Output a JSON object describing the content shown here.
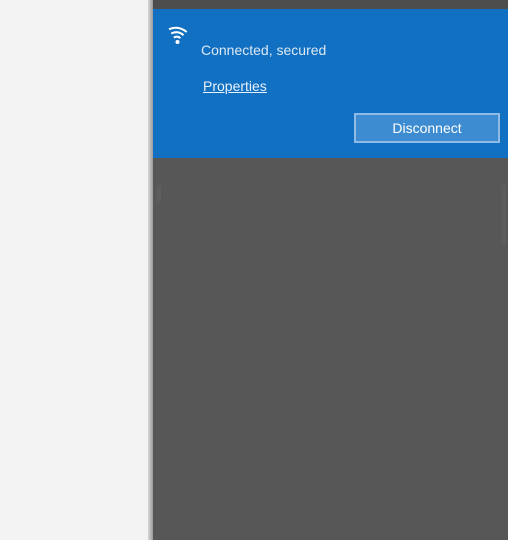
{
  "network": {
    "status": "Connected, secured",
    "properties_label": "Properties",
    "disconnect_label": "Disconnect"
  },
  "icons": {
    "wifi": "wifi-secured-icon"
  },
  "colors": {
    "card_background": "#1170c2",
    "flyout_background": "#575757",
    "left_pane_background": "#f3f3f3",
    "button_background": "#3d8bd0",
    "button_border": "#8fbbe6"
  }
}
